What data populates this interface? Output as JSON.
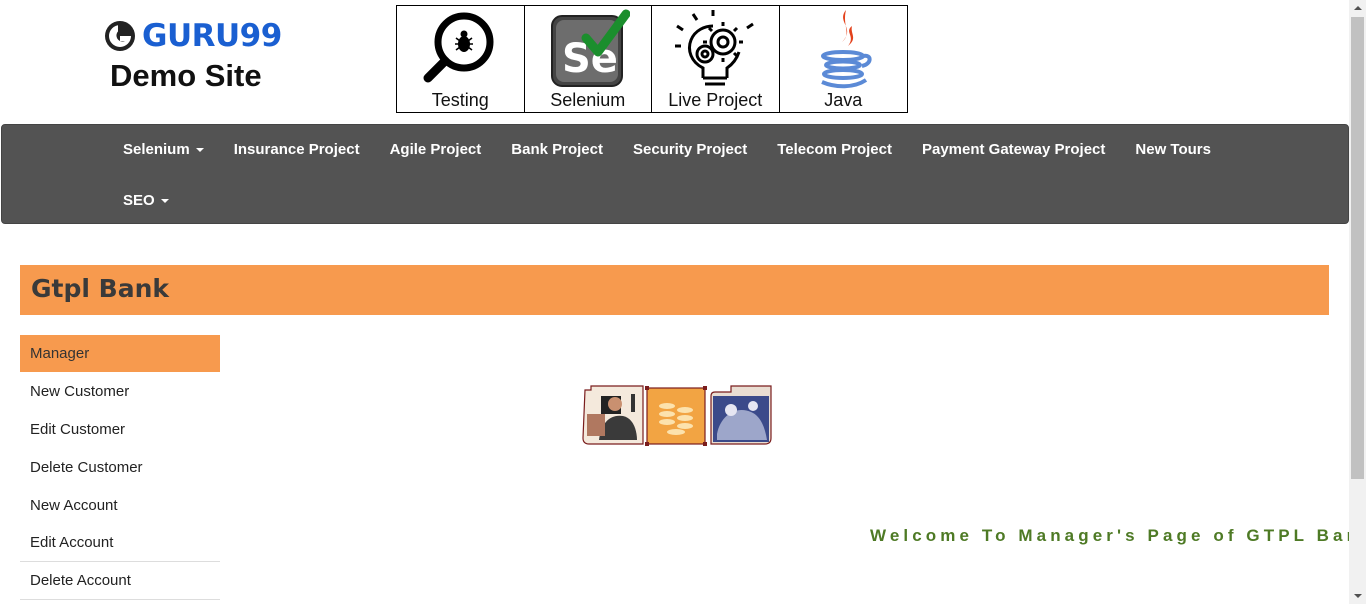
{
  "header": {
    "logo_text": "GURU99",
    "logo_subtitle": "Demo Site",
    "courses": [
      {
        "label": "Testing",
        "icon": "magnifier-bug-icon"
      },
      {
        "label": "Selenium",
        "icon": "selenium-check-icon"
      },
      {
        "label": "Live Project",
        "icon": "lightbulb-gears-icon"
      },
      {
        "label": "Java",
        "icon": "java-cup-icon"
      }
    ]
  },
  "navbar": {
    "items": [
      {
        "label": "Selenium",
        "dropdown": true
      },
      {
        "label": "Insurance Project"
      },
      {
        "label": "Agile Project"
      },
      {
        "label": "Bank Project"
      },
      {
        "label": "Security Project"
      },
      {
        "label": "Telecom Project"
      },
      {
        "label": "Payment Gateway Project"
      },
      {
        "label": "New Tours"
      },
      {
        "label": "SEO",
        "dropdown": true
      }
    ]
  },
  "bank": {
    "title": "Gtpl Bank"
  },
  "menu": {
    "items": [
      {
        "label": "Manager"
      },
      {
        "label": "New Customer"
      },
      {
        "label": "Edit Customer"
      },
      {
        "label": "Delete Customer"
      },
      {
        "label": "New Account"
      },
      {
        "label": "Edit Account"
      },
      {
        "label": "Delete Account"
      }
    ]
  },
  "welcome": {
    "text": "Welcome To Manager's Page of GTPL Bank"
  },
  "colors": {
    "accent": "#f79a4e",
    "navbar": "#535353",
    "logo_blue": "#1a5fd1",
    "welcome_green": "#4e7a25"
  }
}
